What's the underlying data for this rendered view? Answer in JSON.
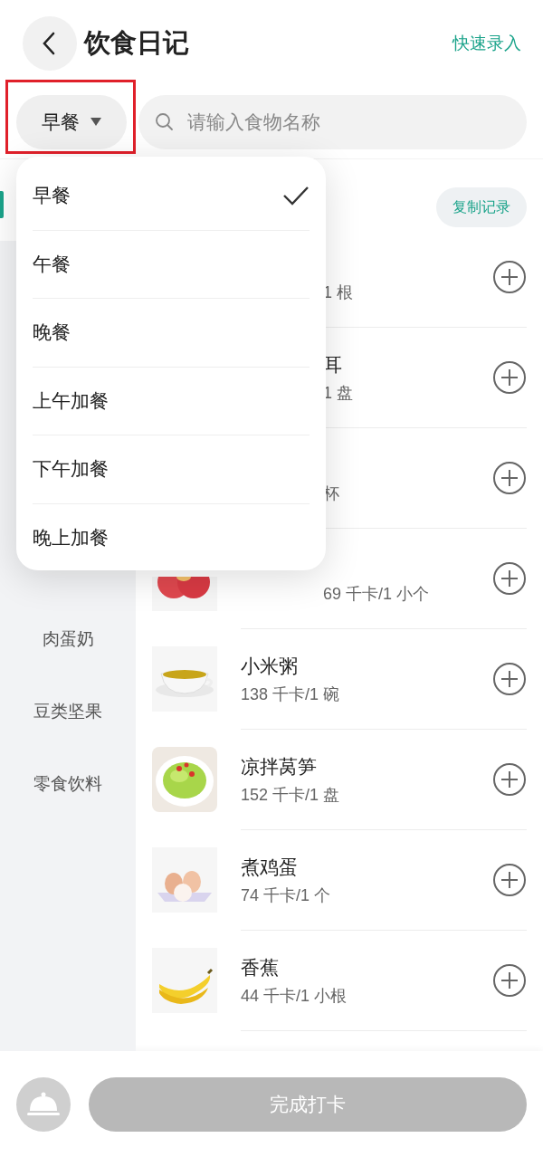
{
  "header": {
    "title": "饮食日记",
    "action": "快速录入"
  },
  "filter": {
    "meal": "早餐",
    "search": {
      "placeholder": "请输入食物名称"
    }
  },
  "sidebar": {
    "items": [
      {
        "selected": true
      },
      {
        "selected": false
      },
      {
        "selected": false
      },
      {
        "selected": false
      },
      {
        "selected": false
      },
      {
        "selected": false
      },
      {
        "label": "肉蛋奶",
        "selected": false
      },
      {
        "label": "豆类坚果",
        "selected": false
      },
      {
        "label": "零食饮料",
        "selected": false
      }
    ]
  },
  "list": {
    "copy_button": "复制记录",
    "rows": [
      {
        "sub": "1 根",
        "covered": true
      },
      {
        "name": "耳",
        "sub": "1 盘",
        "covered": true
      },
      {
        "sub": "杯",
        "covered": true
      },
      {
        "sub": "69 千卡/1 小个",
        "covered": true
      },
      {
        "name": "小米粥",
        "sub": "138 千卡/1 碗",
        "covered": false
      },
      {
        "name": "凉拌莴笋",
        "sub": "152 千卡/1 盘",
        "covered": false
      },
      {
        "name": "煮鸡蛋",
        "sub": "74 千卡/1 个",
        "covered": false
      },
      {
        "name": "香蕉",
        "sub": "44 千卡/1 小根",
        "covered": false
      }
    ]
  },
  "dropdown": {
    "items": [
      {
        "label": "早餐",
        "selected": true
      },
      {
        "label": "午餐",
        "selected": false
      },
      {
        "label": "晚餐",
        "selected": false
      },
      {
        "label": "上午加餐",
        "selected": false
      },
      {
        "label": "下午加餐",
        "selected": false
      },
      {
        "label": "晚上加餐",
        "selected": false
      }
    ]
  },
  "footer": {
    "button": "完成打卡"
  }
}
